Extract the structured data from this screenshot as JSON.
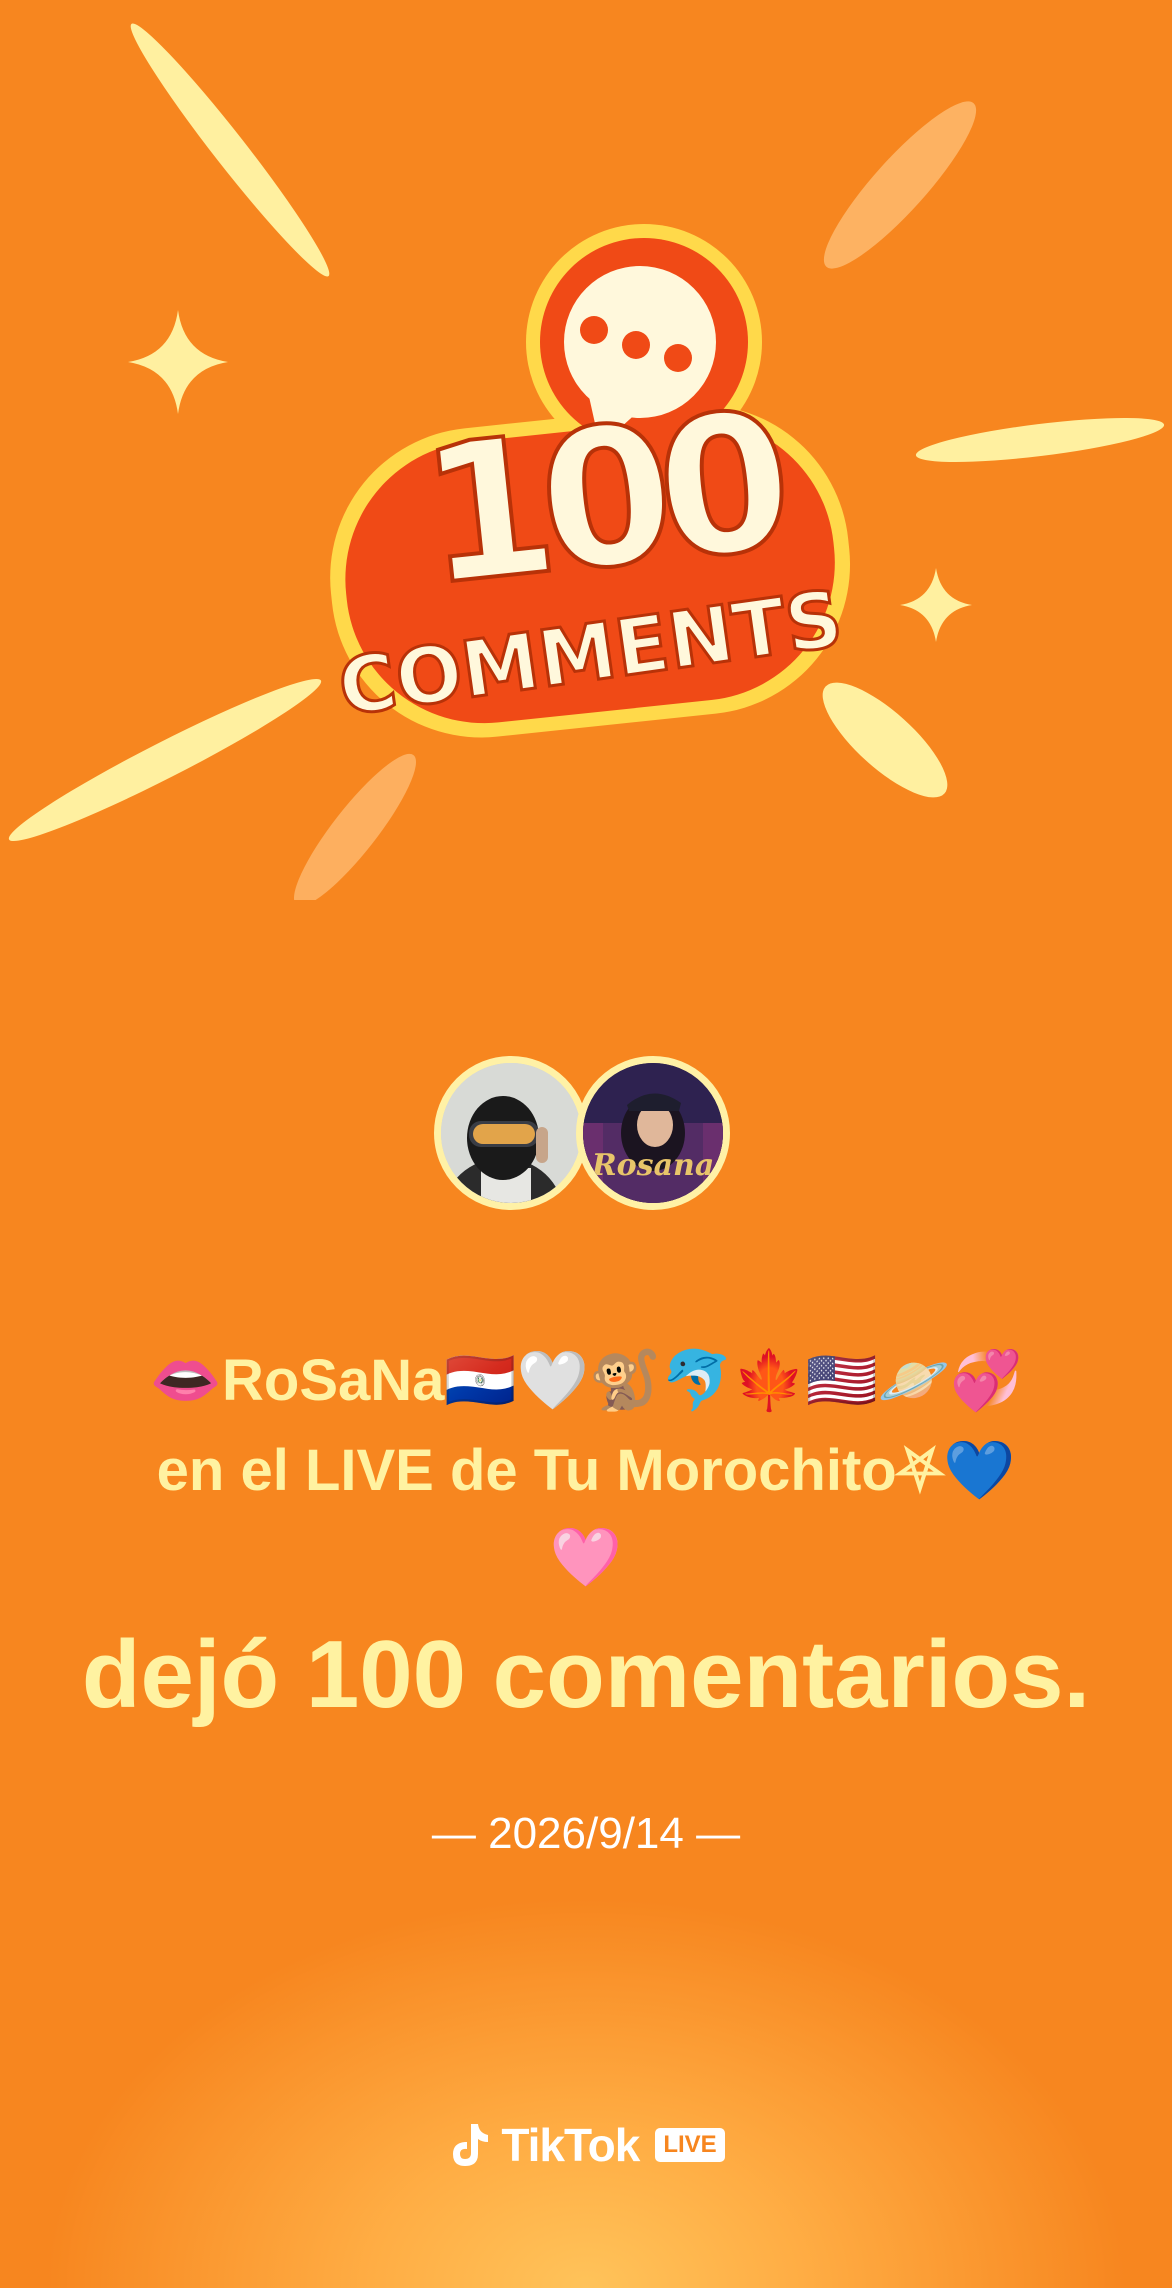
{
  "badge": {
    "number": "100",
    "word": "COMMENTS"
  },
  "avatars": [
    {
      "label": ""
    },
    {
      "label": "Rosana"
    }
  ],
  "message": {
    "user_line": "👄RoSaNa🇵🇾🤍🐒🐬🍁🇺🇸🪐💞",
    "live_line": "en el LIVE de Tu Morochito⛧💙",
    "heart_line": "🩷",
    "action_line": "dejó 100 comentarios."
  },
  "date": "— 2026/9/14 —",
  "brand": {
    "name": "TikTok",
    "badge": "LIVE"
  },
  "colors": {
    "background": "#f7861f",
    "text_accent": "#fff2a1",
    "badge_red": "#f04a16",
    "badge_yellow": "#ffd94a"
  }
}
